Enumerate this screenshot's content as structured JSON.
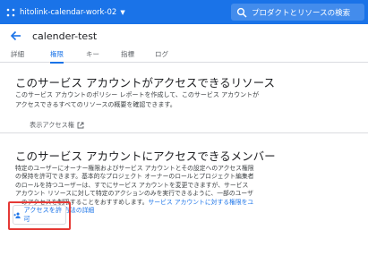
{
  "topbar": {
    "project_name": "hitolink-calendar-work-02",
    "search_placeholder": "プロダクトとリソースの検索"
  },
  "page": {
    "title": "calender-test"
  },
  "tabs": [
    {
      "label": "詳細"
    },
    {
      "label": "権限"
    },
    {
      "label": "キー"
    },
    {
      "label": "指標"
    },
    {
      "label": "ログ"
    }
  ],
  "resources_section": {
    "heading": "このサービス アカウントがアクセスできるリソース",
    "description_lines": [
      "このサービス アカウントのポリシー レポートを作成して、このサービス アカウントが",
      "アクセスできるすべてのリソースの概要を確認できます。"
    ],
    "view_access_link": "表示アクセス権"
  },
  "members_section": {
    "heading": "このサービス アカウントにアクセスできるメンバー",
    "description_lines": [
      "特定のユーザーにオーナー権限およびサービス アカウントとその設定へのアクセス権限",
      "の保持を許可できます。基本的なプロジェクト オーナーのロールとプロジェクト編集者",
      "のロールを持つユーザーは、すでにサービス アカウントを変更できますが、サービス",
      "アカウント リソースに対して特定のアクションのみを実行できるように、一部のユーザ"
    ],
    "line5_text": "ーのアクセスを制限することをおすすめします。",
    "line5_link": "サービス アカウントに対する権限をユ",
    "line6_link": "ーザーに付与する方法の詳細",
    "grant_button": "アクセスを許可"
  },
  "colors": {
    "topbar": "#1a73e8",
    "accent": "#1a73e8",
    "highlight": "#e53935"
  }
}
